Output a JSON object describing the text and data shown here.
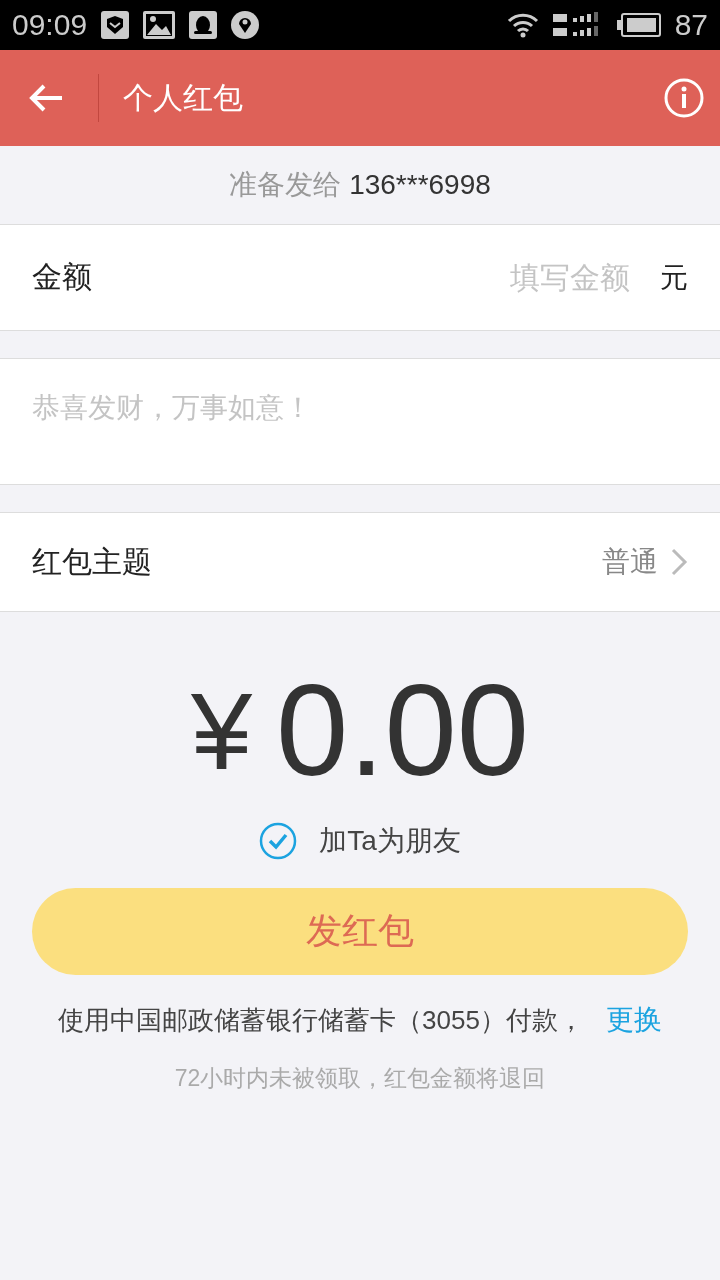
{
  "status_bar": {
    "time": "09:09",
    "battery": "87"
  },
  "header": {
    "title": "个人红包"
  },
  "recipient": {
    "label": "准备发给",
    "phone": "136***6998"
  },
  "amount": {
    "label": "金额",
    "placeholder": "填写金额",
    "unit": "元"
  },
  "message": {
    "placeholder": "恭喜发财，万事如意！"
  },
  "theme": {
    "label": "红包主题",
    "value": "普通"
  },
  "total": {
    "currency": "¥",
    "value": "0.00"
  },
  "add_friend": {
    "label": "加Ta为朋友",
    "checked": true
  },
  "send_button": "发红包",
  "payment": {
    "text": "使用中国邮政储蓄银行储蓄卡（3055）付款，",
    "link": "更换"
  },
  "note": "72小时内未被领取，红包金额将退回"
}
